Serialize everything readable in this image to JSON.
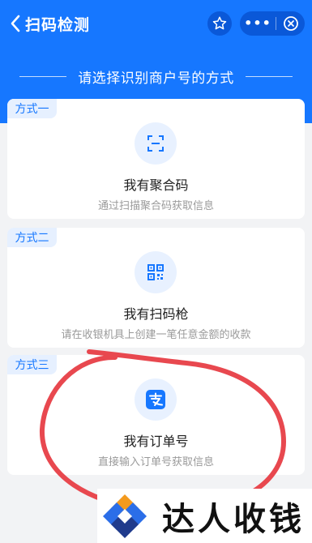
{
  "header": {
    "title": "扫码检测",
    "more_glyph": "•••",
    "subtitle": "请选择识别商户号的方式"
  },
  "methods": [
    {
      "tag": "方式一",
      "title": "我有聚合码",
      "desc": "通过扫描聚合码获取信息",
      "icon": "scan-frame-icon"
    },
    {
      "tag": "方式二",
      "title": "我有扫码枪",
      "desc": "请在收银机具上创建一笔任意金额的收款",
      "icon": "qrcode-icon"
    },
    {
      "tag": "方式三",
      "title": "我有订单号",
      "desc": "直接输入订单号获取信息",
      "icon": "alipay-icon"
    }
  ],
  "watermark": {
    "text": "达人收钱"
  },
  "colors": {
    "brand": "#1677ff",
    "annotation": "#e8484f"
  }
}
